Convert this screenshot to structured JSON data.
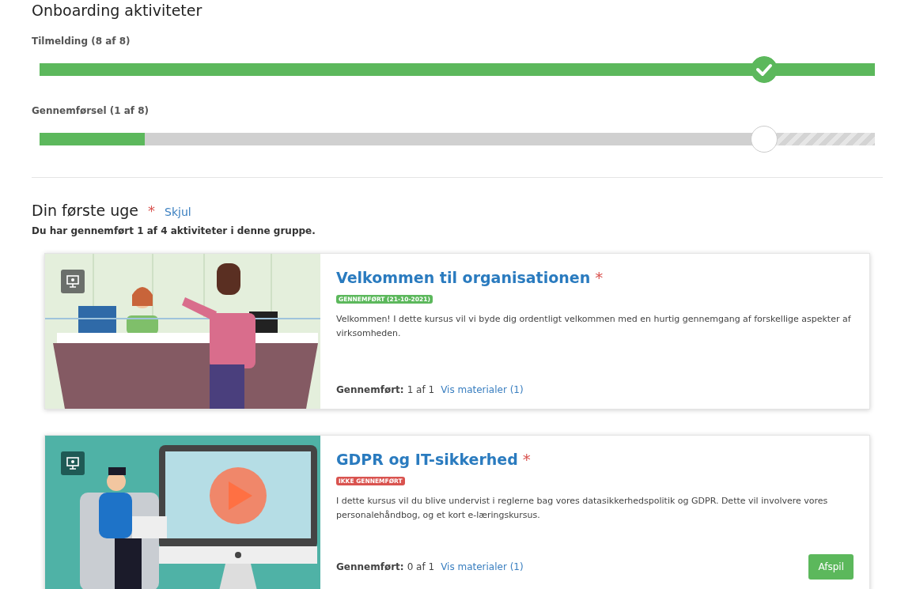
{
  "page_title": "Onboarding aktiviteter",
  "progress": [
    {
      "label": "Tilmelding (8 af 8)",
      "level": 1.0,
      "milestone": {
        "level": 0.865,
        "reached": true
      }
    },
    {
      "label": "Gennemførsel (1 af 8)",
      "level": 0.125,
      "milestone": {
        "level": 0.865,
        "reached": false
      }
    }
  ],
  "group": {
    "title": "Din første uge",
    "required_mark": "*",
    "toggle_link": "Skjul",
    "summary": "Du har gennemført 1 af 4 aktiviteter i denne gruppe.",
    "activities": [
      {
        "kind": "reception",
        "title": "Velkommen til organisationen",
        "required_mark": "*",
        "status": {
          "kind": "done",
          "label": "GENNEMFØRT (21-10-2021)"
        },
        "description": "Velkommen! I dette kursus vil vi byde dig ordentligt velkommen med en hurtig gennemgang af forskellige aspekter af virksomheden.",
        "completed_label": "Gennemført:",
        "completed_value": "1 af 1",
        "materials_link": "Vis materialer (1)"
      },
      {
        "kind": "video",
        "title": "GDPR og IT-sikkerhed",
        "required_mark": "*",
        "status": {
          "kind": "not_done",
          "label": "IKKE GENNEMFØRT"
        },
        "description": "I dette kursus vil du blive undervist i reglerne bag vores datasikkerhedspolitik og GDPR. Dette vil involvere vores personalehåndbog, og et kort e-læringskursus.",
        "completed_label": "Gennemført:",
        "completed_value": "0 af 1",
        "materials_link": "Vis materialer (1)",
        "action": "Afspil"
      }
    ]
  }
}
